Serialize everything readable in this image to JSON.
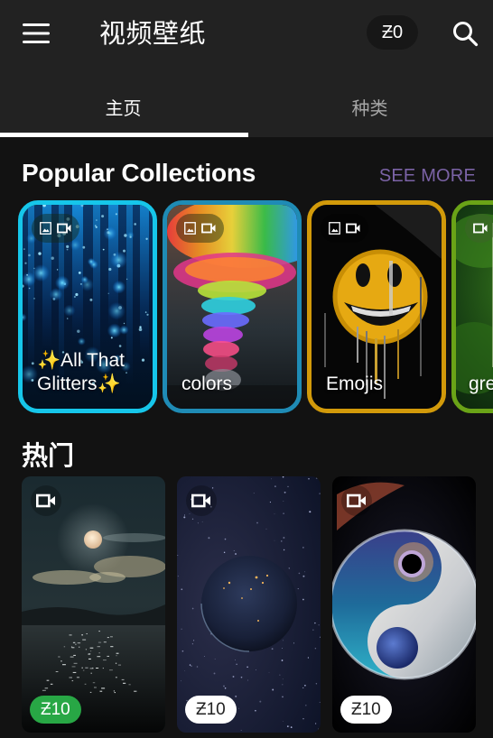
{
  "appbar": {
    "title": "视频壁纸",
    "coin_balance": "Ƶ0",
    "icons": {
      "menu": "hamburger-menu-icon",
      "search": "search-icon"
    }
  },
  "tabs": [
    {
      "label": "主页",
      "active": true
    },
    {
      "label": "种类",
      "active": false
    }
  ],
  "collections": {
    "title": "Popular Collections",
    "see_more": "SEE MORE",
    "see_more_color": "#7b63a6",
    "items": [
      {
        "label": "✨All That Glitters✨",
        "border_color": "#16c6ea",
        "media": [
          "image",
          "video"
        ],
        "theme": "glitter"
      },
      {
        "label": "colors",
        "border_color": "#1f8bb5",
        "media": [
          "image",
          "video"
        ],
        "theme": "rainbow"
      },
      {
        "label": "Emojis",
        "border_color": "#d29a0a",
        "media": [
          "image",
          "video"
        ],
        "theme": "emoji"
      },
      {
        "label": "green",
        "border_color": "#6aa317",
        "media": [
          "video"
        ],
        "theme": "forest"
      }
    ]
  },
  "hot": {
    "title": "热门",
    "items": [
      {
        "name": "moonlit-sea",
        "price": "Ƶ10",
        "price_style": "owned",
        "price_bg": "#28a745",
        "media": "video"
      },
      {
        "name": "earth-night",
        "price": "Ƶ10",
        "price_style": "default",
        "price_bg": "#ffffff",
        "media": "video"
      },
      {
        "name": "cosmic-yin-yang",
        "price": "Ƶ10",
        "price_style": "default",
        "price_bg": "#ffffff",
        "media": "video"
      }
    ]
  }
}
